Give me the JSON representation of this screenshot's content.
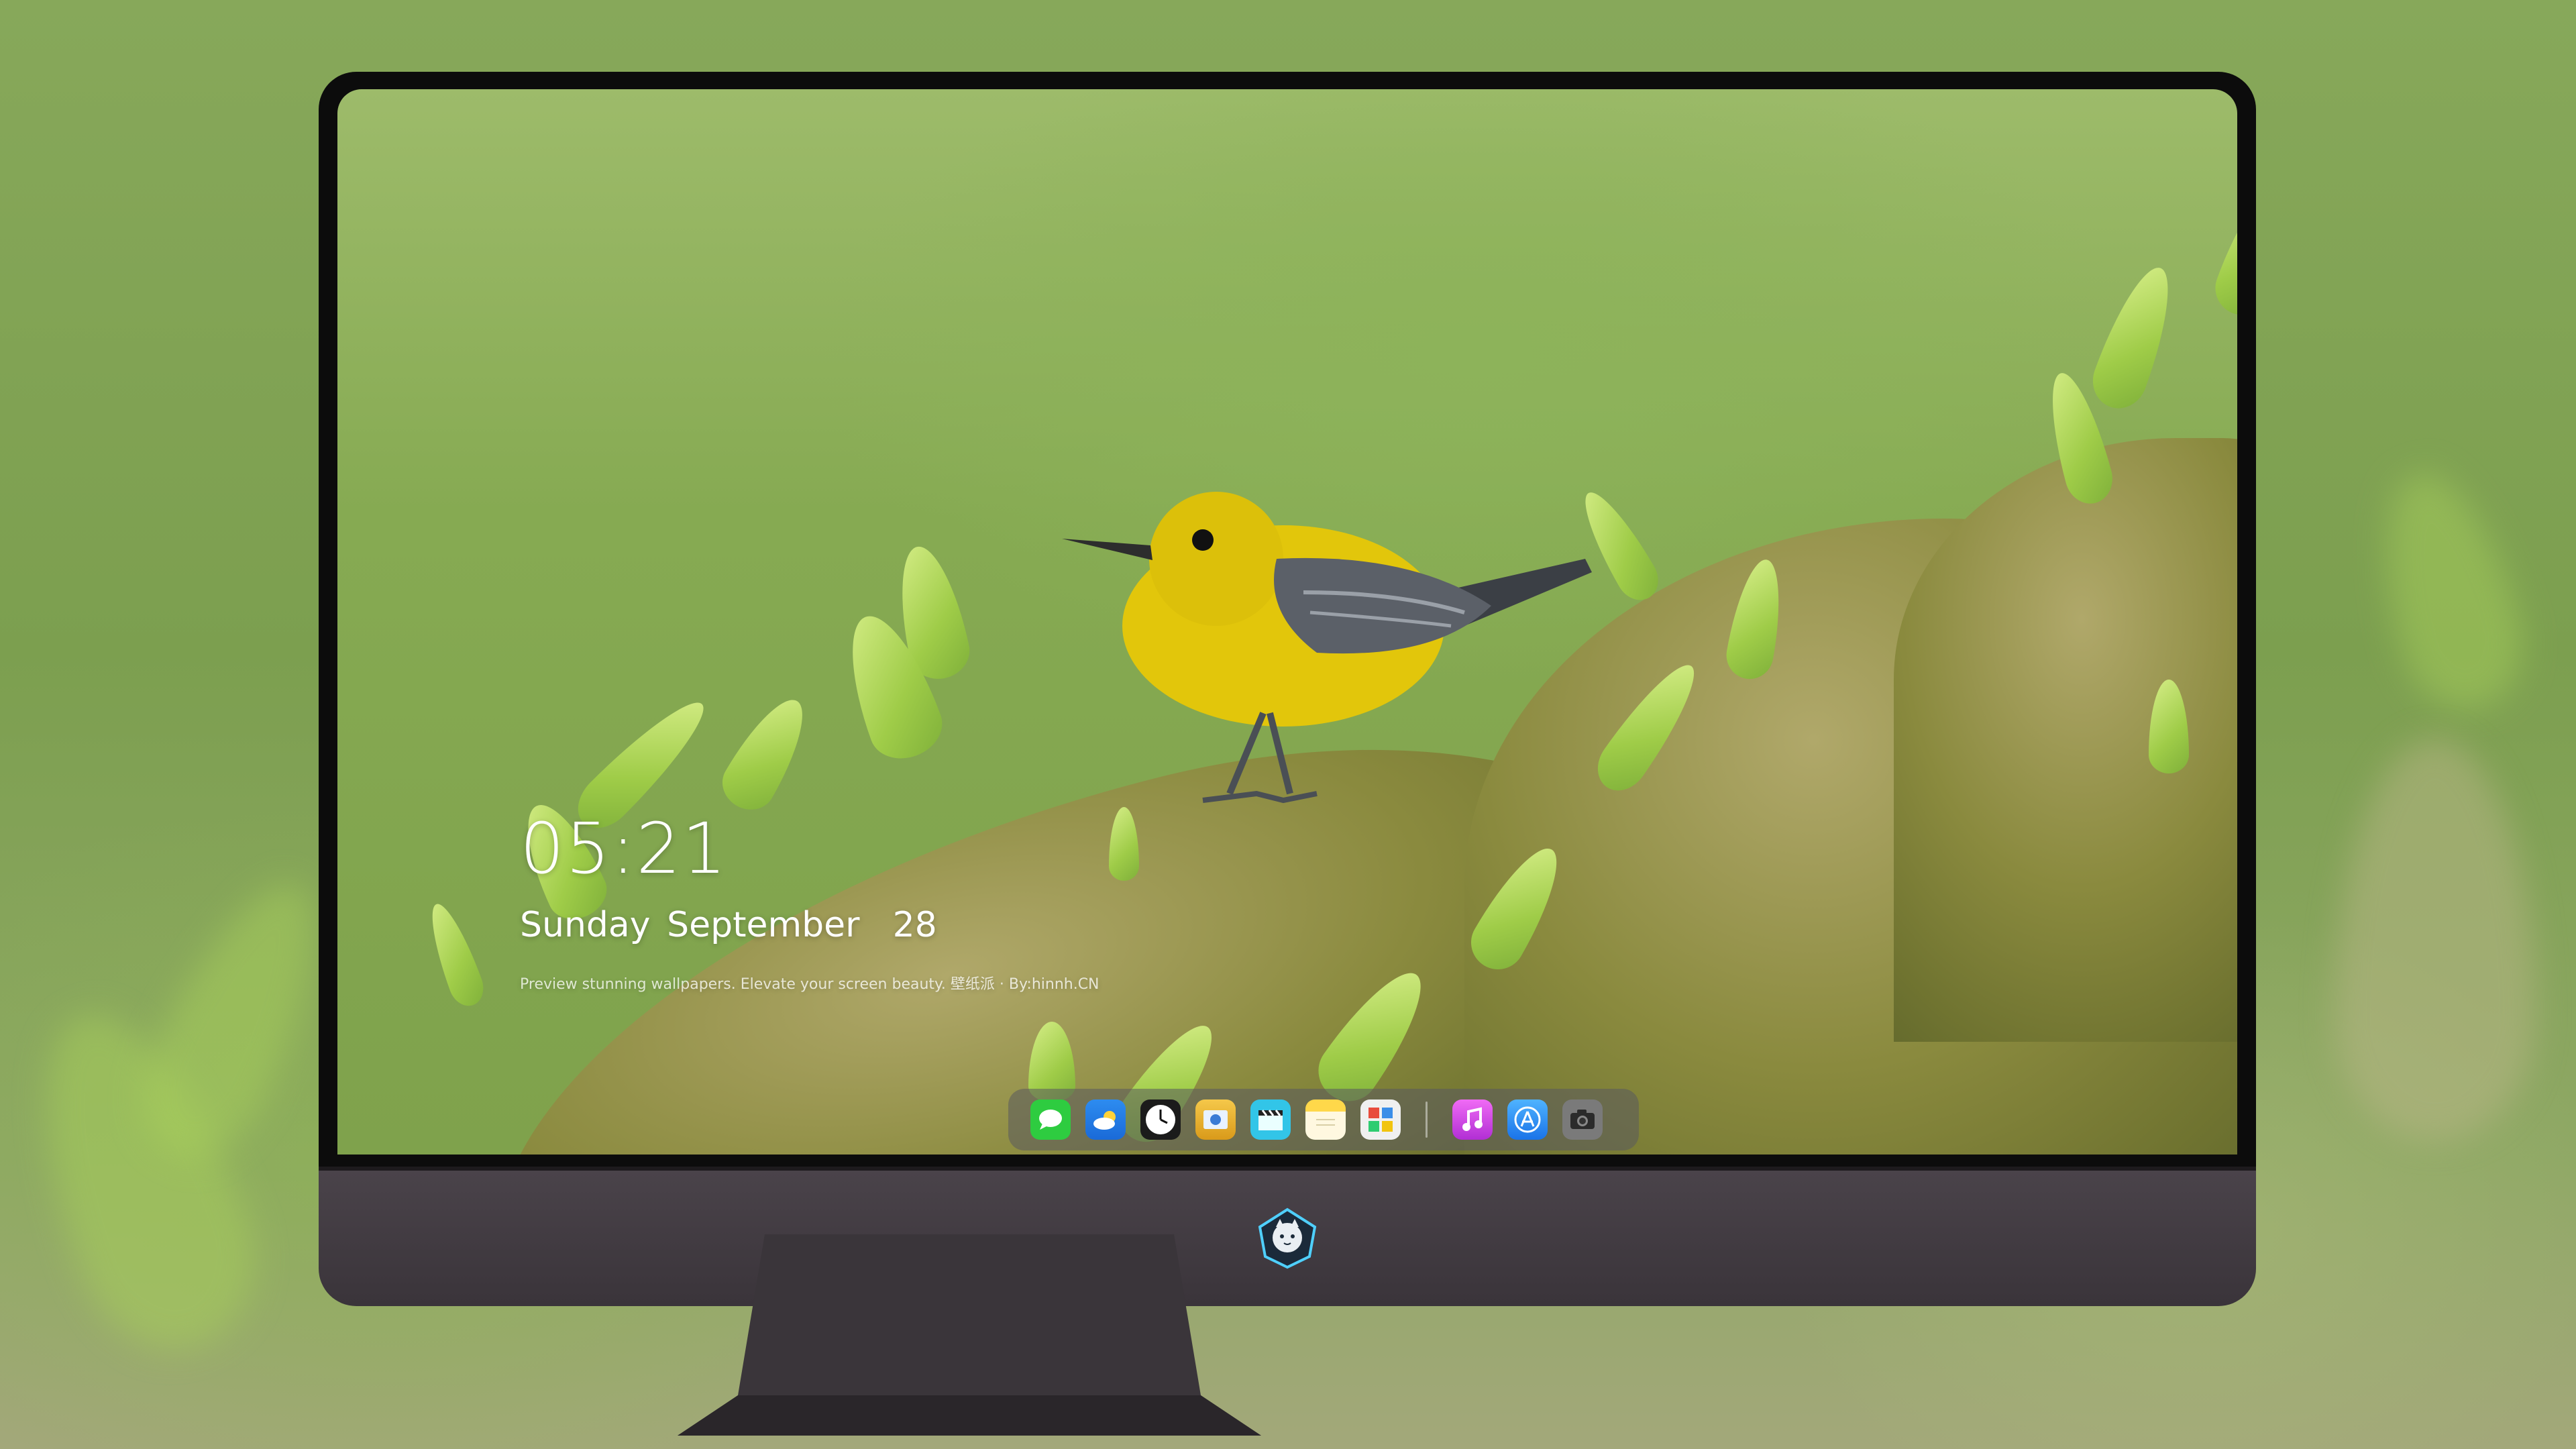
{
  "lockscreen": {
    "time": "05:21",
    "date": "Sunday September  28",
    "tagline": "Preview stunning wallpapers. Elevate your screen beauty. 壁纸派 · By:hinnh.CN"
  },
  "dock": {
    "apps": [
      {
        "name": "Messages",
        "icon": "message-bubble-icon",
        "color": "#2ecc40"
      },
      {
        "name": "Weather",
        "icon": "cloud-icon",
        "color": "#2d8cf0"
      },
      {
        "name": "Clock",
        "icon": "clock-icon",
        "color": "#ffffff"
      },
      {
        "name": "Preview",
        "icon": "preview-icon",
        "color": "#f2b632"
      },
      {
        "name": "Clips",
        "icon": "clapper-icon",
        "color": "#32c5e8"
      },
      {
        "name": "Notes",
        "icon": "notes-icon",
        "color": "#ffd84a"
      },
      {
        "name": "Photos Grid",
        "icon": "photo-grid-icon",
        "color": "#e8e8e8"
      },
      {
        "name": "Music",
        "icon": "music-note-icon",
        "color": "#d93be0"
      },
      {
        "name": "App Store",
        "icon": "app-store-icon",
        "color": "#1e90ff"
      },
      {
        "name": "Camera",
        "icon": "camera-icon",
        "color": "#8a8a8a"
      }
    ]
  },
  "colors": {
    "bezel": "#0c0c0c",
    "chin": "#3f383f",
    "bird_yellow": "#e2c60b"
  }
}
